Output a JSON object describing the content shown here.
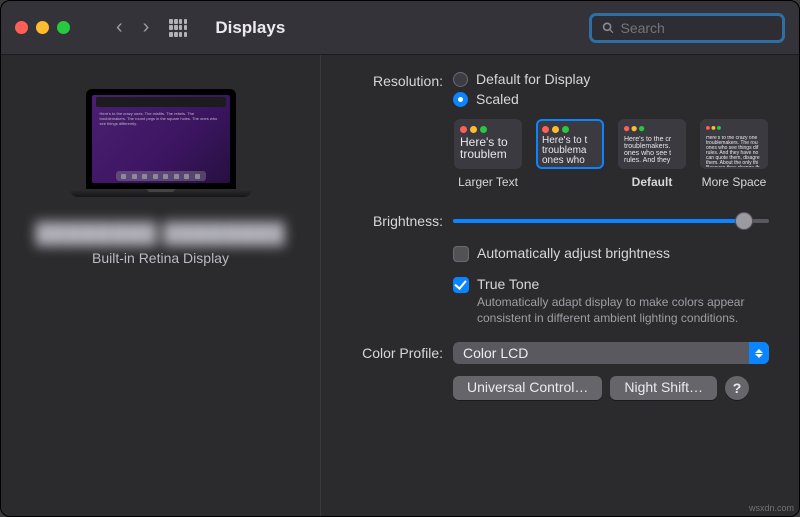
{
  "titlebar": {
    "title": "Displays"
  },
  "search": {
    "placeholder": "Search"
  },
  "device": {
    "name": "████████ ████████",
    "sub": "Built-in Retina Display"
  },
  "resolution": {
    "label": "Resolution:",
    "option_default": "Default for Display",
    "option_scaled": "Scaled",
    "selected": "scaled",
    "thumbs": {
      "t0": {
        "label": "Larger Text",
        "text": "Here's to troublem",
        "font_px": 12
      },
      "t1": {
        "label": "",
        "text": "Here's to t troublema ones who",
        "font_px": 10,
        "selected": true
      },
      "t2": {
        "label": "Default",
        "text": "Here's to the cr troublemakers. ones who see t rules. And they",
        "font_px": 7
      },
      "t3": {
        "label": "More Space",
        "text": "Here's to the crazy one troublemakers. The rou ones who see things dif rules. And they have no can quote them, disagre them. About the only thi Because they change th",
        "font_px": 5
      }
    }
  },
  "brightness": {
    "label": "Brightness:",
    "value_pct": 92
  },
  "auto_bright": {
    "label": "Automatically adjust brightness",
    "checked": false
  },
  "true_tone": {
    "label": "True Tone",
    "checked": true,
    "desc": "Automatically adapt display to make colors appear consistent in different ambient lighting conditions."
  },
  "color_profile": {
    "label": "Color Profile:",
    "value": "Color LCD"
  },
  "buttons": {
    "universal": "Universal Control…",
    "night": "Night Shift…",
    "help": "?"
  },
  "watermark": "wsxdn.com"
}
